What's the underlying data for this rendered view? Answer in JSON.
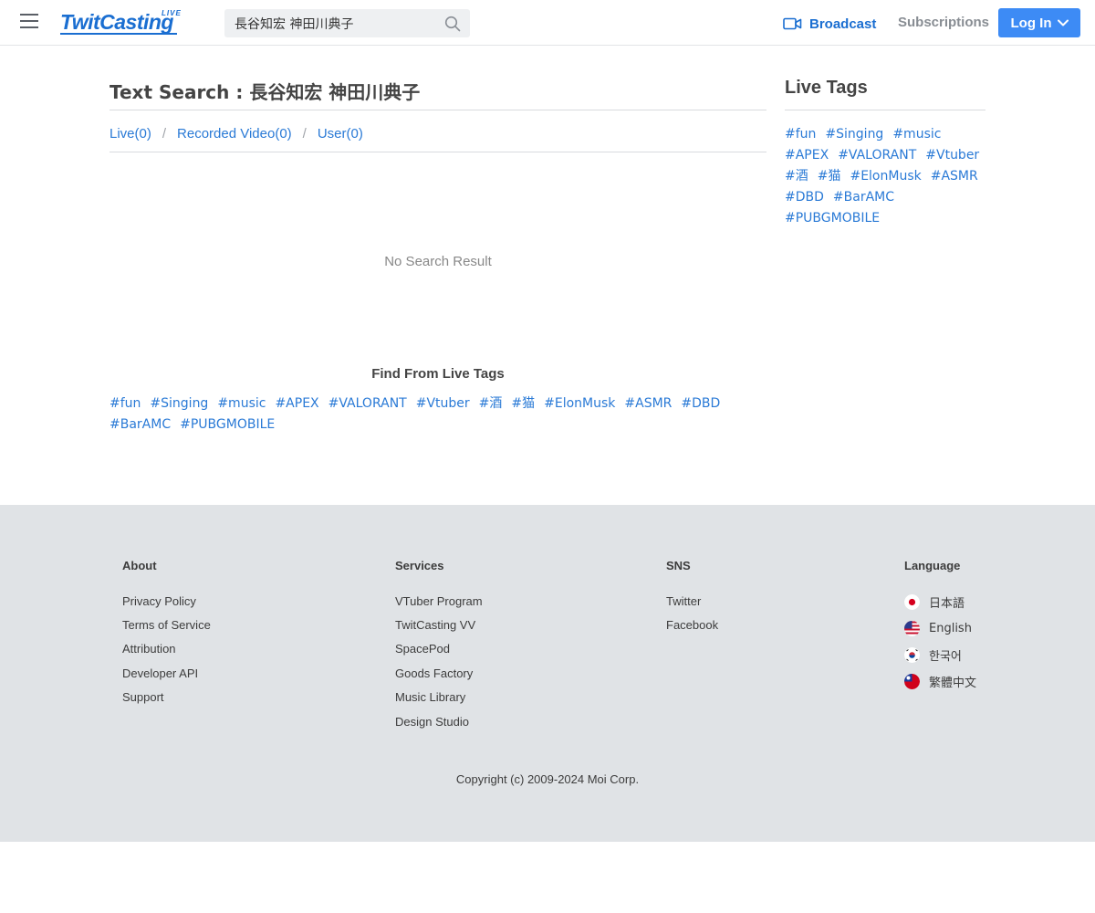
{
  "header": {
    "logo_text": "TwitCasting",
    "logo_sub": "LIVE",
    "search_value": "長谷知宏 神田川典子",
    "broadcast_label": "Broadcast",
    "subscriptions_label": "Subscriptions",
    "login_label": "Log In",
    "colors": {
      "brand": "#1a6ed1",
      "login_bg": "#3d8bf5"
    }
  },
  "main": {
    "title": "Text Search : 長谷知宏 神田川典子",
    "tabs": [
      {
        "label": "Live(0)"
      },
      {
        "label": "Recorded Video(0)"
      },
      {
        "label": "User(0)"
      }
    ],
    "tab_separator": "/",
    "no_result": "No Search Result",
    "find_title": "Find From Live Tags",
    "tags": [
      "#fun",
      "#Singing",
      "#music",
      "#APEX",
      "#VALORANT",
      "#Vtuber",
      "#酒",
      "#猫",
      "#ElonMusk",
      "#ASMR",
      "#DBD",
      "#BarAMC",
      "#PUBGMOBILE"
    ]
  },
  "sidebar": {
    "title": "Live Tags",
    "tags": [
      "#fun",
      "#Singing",
      "#music",
      "#APEX",
      "#VALORANT",
      "#Vtuber",
      "#酒",
      "#猫",
      "#ElonMusk",
      "#ASMR",
      "#DBD",
      "#BarAMC",
      "#PUBGMOBILE"
    ]
  },
  "footer": {
    "about": {
      "heading": "About",
      "links": [
        "Privacy Policy",
        "Terms of Service",
        "Attribution",
        "Developer API",
        "Support"
      ]
    },
    "services": {
      "heading": "Services",
      "links": [
        "VTuber Program",
        "TwitCasting VV",
        "SpacePod",
        "Goods Factory",
        "Music Library",
        "Design Studio"
      ]
    },
    "sns": {
      "heading": "SNS",
      "links": [
        "Twitter",
        "Facebook"
      ]
    },
    "language": {
      "heading": "Language",
      "items": [
        {
          "label": "日本語",
          "flag": "japan-flag-icon"
        },
        {
          "label": "English",
          "flag": "us-flag-icon"
        },
        {
          "label": "한국어",
          "flag": "korea-flag-icon"
        },
        {
          "label": "繁體中文",
          "flag": "taiwan-flag-icon"
        }
      ]
    },
    "copyright": "Copyright (c) 2009-2024 Moi Corp."
  }
}
